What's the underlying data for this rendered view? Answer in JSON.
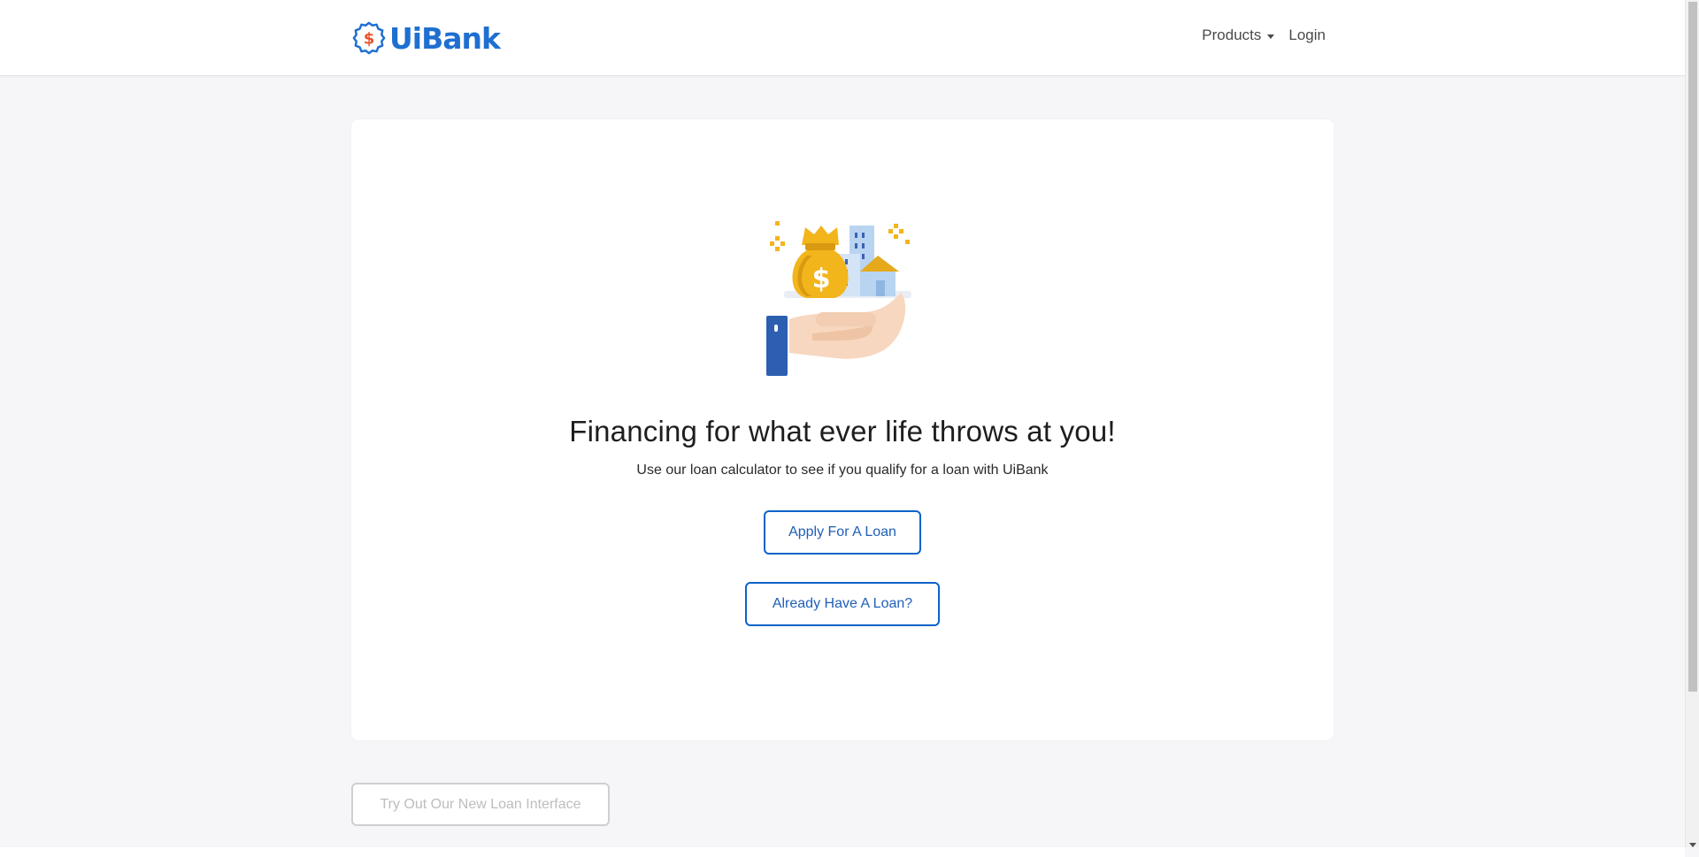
{
  "brand": {
    "name": "UiBank",
    "logo_icon": "dollar-badge-icon",
    "color": "#1f6fd1",
    "accent": "#e9542c"
  },
  "nav": {
    "products_label": "Products",
    "login_label": "Login"
  },
  "hero": {
    "illustration": "money-bag-buildings-hand-icon",
    "title": "Financing for what ever life throws at you!",
    "subtitle": "Use our loan calculator to see if you qualify for a loan with UiBank"
  },
  "actions": {
    "apply_label": "Apply For A Loan",
    "have_loan_label": "Already Have A Loan?",
    "new_interface_label": "Try Out Our New Loan Interface"
  },
  "colors": {
    "primary_button_border": "#0d63c9",
    "disabled_button_border": "#cfcfcf",
    "page_background": "#f6f6f9"
  }
}
